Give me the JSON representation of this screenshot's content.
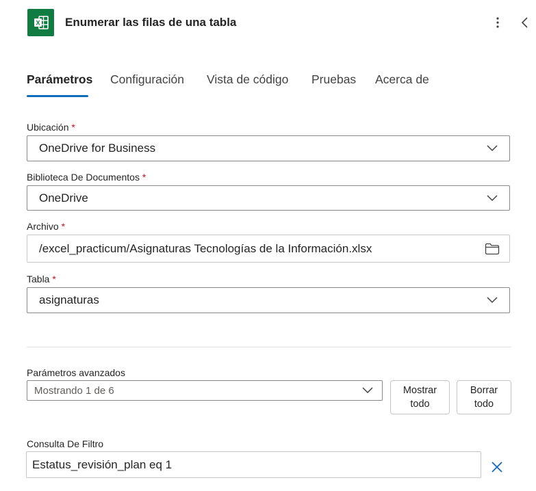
{
  "header": {
    "app_icon_name": "excel-icon",
    "app_icon_letter": "X",
    "title": "Enumerar las filas de una tabla",
    "accent_color": "#107c41"
  },
  "tabs": [
    {
      "label": "Parámetros",
      "active": true
    },
    {
      "label": "Configuración",
      "active": false
    },
    {
      "label": "Vista de código",
      "active": false
    },
    {
      "label": "Pruebas",
      "active": false
    },
    {
      "label": "Acerca de",
      "active": false
    }
  ],
  "fields": {
    "location": {
      "label": "Ubicación",
      "required": "*",
      "value": "OneDrive for Business"
    },
    "library": {
      "label": "Biblioteca De Documentos",
      "required": "*",
      "value": "OneDrive"
    },
    "file": {
      "label": "Archivo",
      "required": "*",
      "value": "/excel_practicum/Asignaturas Tecnologías de la Información.xlsx"
    },
    "table": {
      "label": "Tabla",
      "required": "*",
      "value": "asignaturas"
    }
  },
  "advanced": {
    "label": "Parámetros avanzados",
    "select_value": "Mostrando 1 de 6",
    "show_all_line1": "Mostrar",
    "show_all_line2": "todo",
    "clear_all_line1": "Borrar",
    "clear_all_line2": "todo"
  },
  "filter": {
    "label": "Consulta De Filtro",
    "value": "Estatus_revisión_plan eq 1"
  },
  "colors": {
    "tab_active_underline": "#0f6cbd",
    "required": "#c50f1f",
    "clear_icon": "#0f6cbd"
  }
}
